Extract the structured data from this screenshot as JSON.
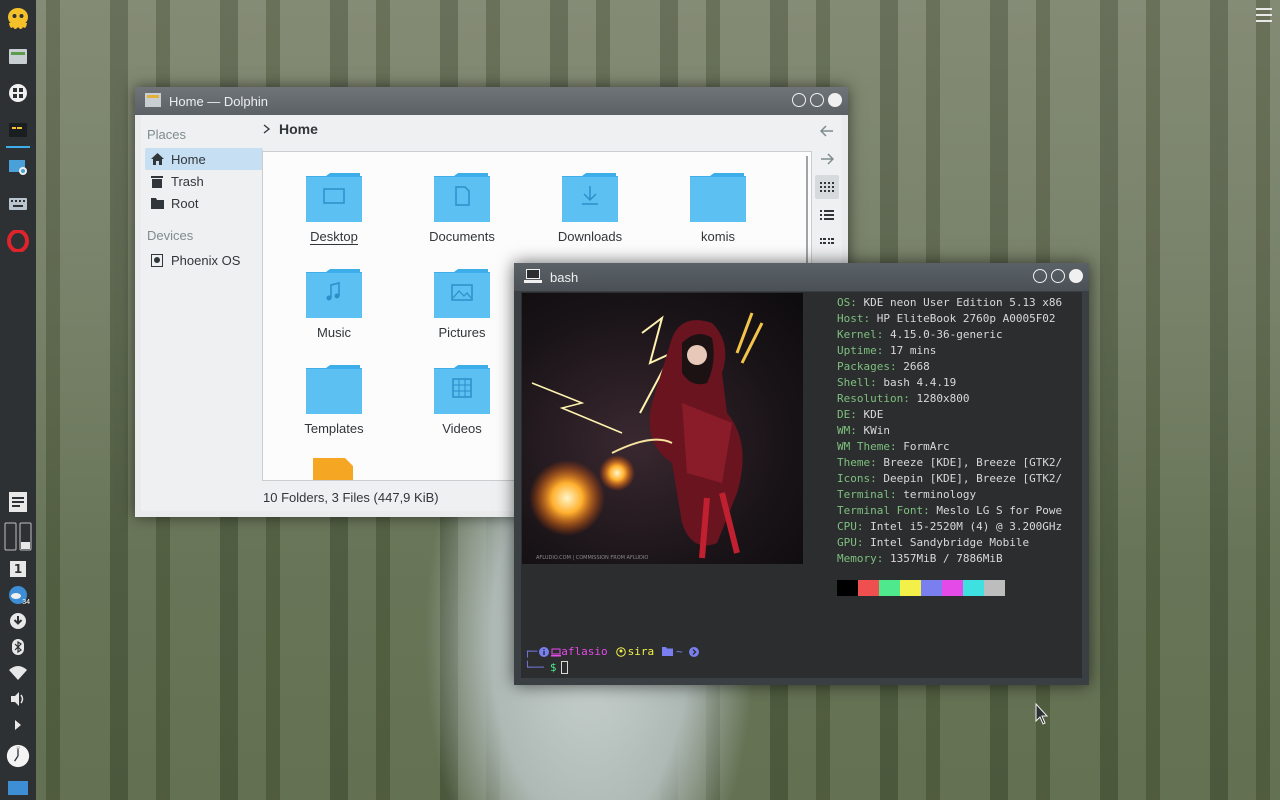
{
  "desktop": {
    "hamburger_icon": "menu-icon"
  },
  "panel": {
    "top_icons": [
      "octopus-logo-icon",
      "dolphin-file-manager-icon",
      "windows-grid-icon",
      "terminal-icon",
      "screenshot-icon",
      "keyboard-icon",
      "opera-browser-icon"
    ],
    "bottom_icons": [
      "notes-icon",
      "pager-icon",
      "desktop-number-icon",
      "weather-icon",
      "download-icon",
      "bluetooth-icon",
      "wifi-icon",
      "volume-icon",
      "expand-arrow-icon",
      "clock-icon",
      "show-desktop-icon"
    ],
    "desktop_number": "1",
    "weather_temp": "34"
  },
  "dolphin": {
    "title": "Home — Dolphin",
    "places_title": "Places",
    "places": [
      {
        "label": "Home",
        "icon": "home-icon",
        "selected": true
      },
      {
        "label": "Trash",
        "icon": "trash-icon"
      },
      {
        "label": "Root",
        "icon": "folder-icon"
      }
    ],
    "devices_title": "Devices",
    "devices": [
      {
        "label": "Phoenix OS",
        "icon": "drive-icon"
      }
    ],
    "breadcrumb": "Home",
    "files": [
      {
        "label": "Desktop",
        "icon": "desktop-folder-icon"
      },
      {
        "label": "Documents",
        "icon": "documents-folder-icon"
      },
      {
        "label": "Downloads",
        "icon": "downloads-folder-icon"
      },
      {
        "label": "komis",
        "icon": "folder-icon"
      },
      {
        "label": "Music",
        "icon": "music-folder-icon"
      },
      {
        "label": "Pictures",
        "icon": "pictures-folder-icon"
      },
      {
        "label": "Templates",
        "icon": "folder-icon"
      },
      {
        "label": "Videos",
        "icon": "videos-folder-icon"
      }
    ],
    "status": "10 Folders, 3 Files (447,9 KiB)"
  },
  "terminal": {
    "title": "bash",
    "art_credit": "AFLUDIO.COM | COMMISSION FROM AFLUDIO",
    "info": [
      {
        "key": "OS:",
        "value": " KDE neon User Edition 5.13 x86"
      },
      {
        "key": "Host:",
        "value": " HP EliteBook 2760p A0005F02"
      },
      {
        "key": "Kernel:",
        "value": " 4.15.0-36-generic"
      },
      {
        "key": "Uptime:",
        "value": " 17 mins"
      },
      {
        "key": "Packages:",
        "value": " 2668"
      },
      {
        "key": "Shell:",
        "value": " bash 4.4.19"
      },
      {
        "key": "Resolution:",
        "value": " 1280x800"
      },
      {
        "key": "DE:",
        "value": " KDE"
      },
      {
        "key": "WM:",
        "value": " KWin"
      },
      {
        "key": "WM Theme:",
        "value": " FormArc"
      },
      {
        "key": "Theme:",
        "value": " Breeze [KDE], Breeze [GTK2/"
      },
      {
        "key": "Icons:",
        "value": " Deepin [KDE], Breeze [GTK2/"
      },
      {
        "key": "Terminal:",
        "value": " terminology"
      },
      {
        "key": "Terminal Font:",
        "value": " Meslo LG S for Powe"
      },
      {
        "key": "CPU:",
        "value": " Intel i5-2520M (4) @ 3.200GHz"
      },
      {
        "key": "GPU:",
        "value": " Intel Sandybridge Mobile"
      },
      {
        "key": "Memory:",
        "value": " 1357MiB / 7886MiB"
      }
    ],
    "swatches": [
      "#000000",
      "#ef4f4f",
      "#4fe88c",
      "#f3f04a",
      "#7a7ff0",
      "#e44ae8",
      "#3ee0e0",
      "#bdbdbd"
    ],
    "prompt": {
      "user": "aflasio",
      "host": "sira",
      "dir": "~",
      "symbol": "$"
    }
  }
}
